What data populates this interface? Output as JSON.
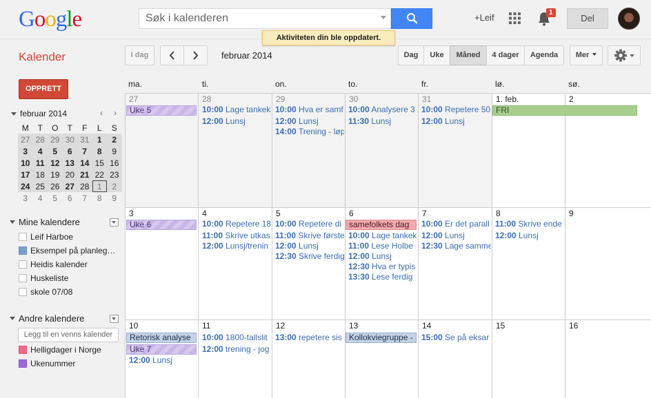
{
  "header": {
    "logo_letters": [
      "G",
      "o",
      "o",
      "g",
      "l",
      "e"
    ],
    "search_placeholder": "Søk i kalenderen",
    "plus_user": "+Leif",
    "notification_count": "1",
    "share_label": "Del",
    "toast": "Aktiviteten din ble oppdatert."
  },
  "toolbar": {
    "app_name": "Kalender",
    "today_label": "I dag",
    "prev_symbol": "‹",
    "next_symbol": "›",
    "current_period": "februar 2014",
    "views": {
      "day": "Dag",
      "week": "Uke",
      "month": "Måned",
      "four_days": "4 dager",
      "agenda": "Agenda"
    },
    "more_label": "Mer",
    "colors": {
      "accent": "#d14836",
      "search_blue": "#4285f4"
    }
  },
  "sidebar": {
    "create_label": "OPPRETT",
    "mini_calendar": {
      "title": "februar 2014",
      "prev": "‹",
      "next": "›",
      "weekdays": [
        "M",
        "T",
        "O",
        "T",
        "F",
        "L",
        "S"
      ],
      "weeks": [
        [
          "27",
          "28",
          "29",
          "30",
          "31",
          "1",
          "2"
        ],
        [
          "3",
          "4",
          "5",
          "6",
          "7",
          "8",
          "9"
        ],
        [
          "10",
          "11",
          "12",
          "13",
          "14",
          "15",
          "16"
        ],
        [
          "17",
          "18",
          "19",
          "20",
          "21",
          "22",
          "23"
        ],
        [
          "24",
          "25",
          "26",
          "27",
          "28",
          "1",
          "2"
        ],
        [
          "3",
          "4",
          "5",
          "6",
          "7",
          "8",
          "9"
        ]
      ]
    },
    "my_calendars_title": "Mine kalendere",
    "my_calendars": [
      {
        "label": "Leif Harboe",
        "color": "#ffffff"
      },
      {
        "label": "Eksempel på planleg…",
        "color": "#7a9fcf"
      },
      {
        "label": "Heidis kalender",
        "color": "#ffffff"
      },
      {
        "label": "Huskeliste",
        "color": "#ffffff"
      },
      {
        "label": "skole 07/08",
        "color": "#ffffff"
      }
    ],
    "other_calendars_title": "Andre kalendere",
    "add_friend_placeholder": "Legg til en venns kalender",
    "other_calendars": [
      {
        "label": "Helligdager i Norge",
        "color": "#f06b84"
      },
      {
        "label": "Ukenummer",
        "color": "#9e69d6"
      }
    ]
  },
  "month": {
    "weekday_headers": [
      "ma.",
      "ti.",
      "on.",
      "to.",
      "fr.",
      "lø.",
      "sø."
    ],
    "weeks": [
      {
        "days": [
          "27",
          "28",
          "29",
          "30",
          "31",
          "1. feb.",
          "2"
        ],
        "allday": [
          {
            "label": "Uke 5",
            "style": "week"
          },
          {
            "label": "FRI",
            "style": "green"
          }
        ],
        "events": [
          [],
          [
            {
              "time": "10:00",
              "title": "Lage tankek"
            },
            {
              "time": "12:00",
              "title": "Lunsj"
            }
          ],
          [
            {
              "time": "10:00",
              "title": "Hva er samf"
            },
            {
              "time": "12:00",
              "title": "Lunsj"
            },
            {
              "time": "14:00",
              "title": "Trening - løp"
            }
          ],
          [
            {
              "time": "10:00",
              "title": "Analysere 3"
            },
            {
              "time": "11:30",
              "title": "Lunsj"
            }
          ],
          [
            {
              "time": "10:00",
              "title": "Repetere 50"
            },
            {
              "time": "12:00",
              "title": "Lunsj"
            }
          ],
          [],
          []
        ]
      },
      {
        "days": [
          "3",
          "4",
          "5",
          "6",
          "7",
          "8",
          "9"
        ],
        "allday": [
          {
            "label": "Uke 6",
            "style": "week"
          },
          {
            "label": "samefolkets dag",
            "style": "red"
          }
        ],
        "events": [
          [],
          [
            {
              "time": "10:00",
              "title": "Repetere 18"
            },
            {
              "time": "11:00",
              "title": "Skrive utkas"
            },
            {
              "time": "12:00",
              "title": "Lunsj/trenin"
            }
          ],
          [
            {
              "time": "10:00",
              "title": "Repetere di"
            },
            {
              "time": "11:00",
              "title": "Skrive første"
            },
            {
              "time": "12:00",
              "title": "Lunsj"
            },
            {
              "time": "12:30",
              "title": "Skrive ferdig"
            }
          ],
          [
            {
              "time": "10:00",
              "title": "Lage tankek"
            },
            {
              "time": "11:00",
              "title": "Lese Holbe"
            },
            {
              "time": "12:00",
              "title": "Lunsj"
            },
            {
              "time": "12:30",
              "title": "Hva er typis"
            },
            {
              "time": "13:30",
              "title": "Lese ferdig"
            }
          ],
          [
            {
              "time": "10:00",
              "title": "Er det parall"
            },
            {
              "time": "12:00",
              "title": "Lunsj"
            },
            {
              "time": "12:30",
              "title": "Lage samme"
            }
          ],
          [
            {
              "time": "11:00",
              "title": "Skrive ende"
            },
            {
              "time": "12:00",
              "title": "Lunsj"
            }
          ],
          []
        ]
      },
      {
        "days": [
          "10",
          "11",
          "12",
          "13",
          "14",
          "15",
          "16"
        ],
        "allday": [
          {
            "label": "Retorisk analyse",
            "style": "blue"
          },
          {
            "label": "Uke 7",
            "style": "week"
          },
          {
            "label": "Kollokviegruppe -",
            "style": "blue"
          }
        ],
        "events": [
          [
            {
              "time": "12:00",
              "title": "Lunsj"
            }
          ],
          [
            {
              "time": "10:00",
              "title": "1800-tallslit"
            },
            {
              "time": "12:00",
              "title": "trening - jog"
            }
          ],
          [
            {
              "time": "13:00",
              "title": "repetere sis"
            }
          ],
          [],
          [
            {
              "time": "15:00",
              "title": "Se på eksar"
            }
          ],
          [],
          []
        ]
      }
    ]
  }
}
